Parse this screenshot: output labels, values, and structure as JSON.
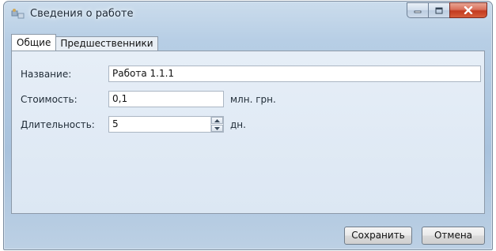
{
  "window": {
    "title": "Сведения о работе",
    "controls": {
      "minimize_icon": "minimize-icon",
      "maximize_icon": "maximize-icon",
      "close_icon": "close-icon"
    }
  },
  "tabs": [
    {
      "label": "Общие",
      "active": true
    },
    {
      "label": "Предшественники",
      "active": false
    }
  ],
  "form": {
    "name_label": "Название:",
    "name_value": "Работа 1.1.1",
    "cost_label": "Стоимость:",
    "cost_value": "0,1",
    "cost_unit": "млн. грн.",
    "duration_label": "Длительность:",
    "duration_value": "5",
    "duration_unit": "дн."
  },
  "buttons": {
    "save": "Сохранить",
    "cancel": "Отмена"
  },
  "colors": {
    "frame": "#b7cee5",
    "panel": "#e2ebf5",
    "close_button": "#c7432a"
  }
}
